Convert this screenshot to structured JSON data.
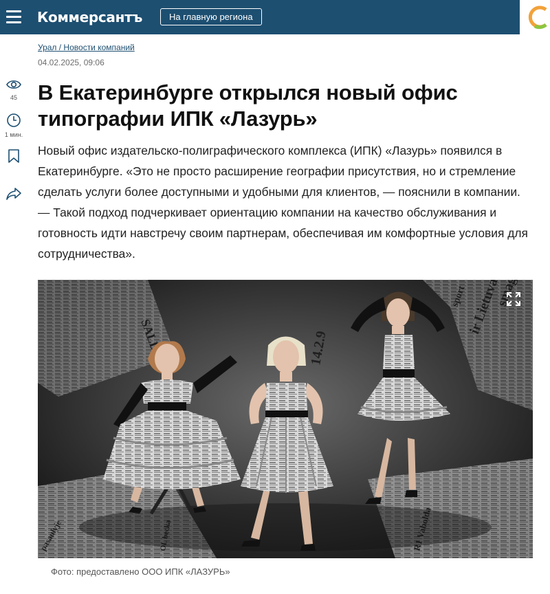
{
  "header": {
    "logo": "Коммерсантъ",
    "region_button": "На главную региона",
    "menu_icon": "hamburger-menu-icon",
    "partner_logo_icon": "ring-logo-icon"
  },
  "article": {
    "breadcrumb": "Урал / Новости компаний",
    "date": "04.02.2025, 09:06",
    "title": "В Екатеринбурге открылся новый офис типографии ИПК «Лазурь»",
    "lead": "Новый офис издательско-полиграфического комплекса (ИПК) «Лазурь» появился в Екатеринбурге. «Это не просто расширение географии присутствия, но и стремление сделать услуги более доступными и удобными для клиентов, — пояснили в компании. — Такой подход подчеркивает ориентацию компании на качество обслуживания и готовность идти навстречу своим партнерам, обеспечивая им комфортные условия для сотрудничества».",
    "photo_caption": "Фото: предоставлено ООО ИПК «ЛАЗУРЬ»"
  },
  "sidebar": {
    "views": "45",
    "read_time": "1 мин.",
    "icons": [
      "eye-icon",
      "clock-icon",
      "bookmark-icon",
      "share-icon"
    ]
  },
  "photo": {
    "newspaper_words": [
      "SALDAS",
      "sport",
      "smagnuma",
      "ir Lietuva",
      "14.2.9",
      "R1 Vabolda",
      "OL becka",
      "pasaulyje"
    ]
  },
  "colors": {
    "header_bg": "#1d4f71",
    "link": "#1d4f71",
    "accent_ring": "#f2a23a"
  }
}
